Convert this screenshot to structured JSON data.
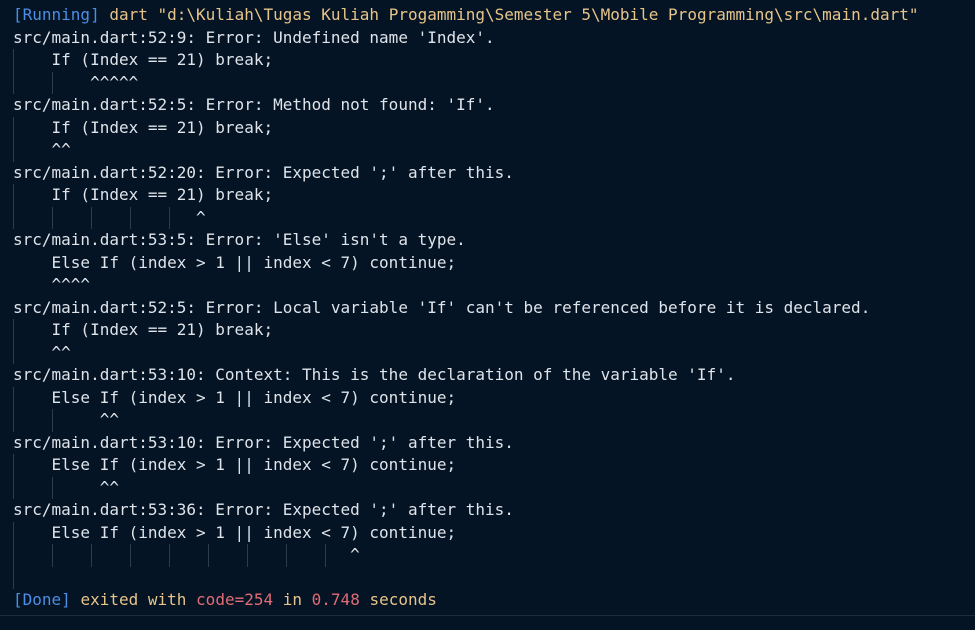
{
  "running_line": {
    "status": "[Running]",
    "command": "dart \"d:\\Kuliah\\Tugas Kuliah Progamming\\Semester 5\\Mobile Programming\\src\\main.dart\""
  },
  "errors": [
    {
      "header": "src/main.dart:52:9: Error: Undefined name 'Index'.",
      "code": "    If (Index == 21) break;",
      "marker": "        ^^^^^"
    },
    {
      "header": "src/main.dart:52:5: Error: Method not found: 'If'.",
      "code": "    If (Index == 21) break;",
      "marker": "    ^^"
    },
    {
      "header": "src/main.dart:52:20: Error: Expected ';' after this.",
      "code": "    If (Index == 21) break;",
      "marker": "                   ^"
    },
    {
      "header": "src/main.dart:53:5: Error: 'Else' isn't a type.",
      "code": "    Else If (index > 1 || index < 7) continue;",
      "marker": "    ^^^^"
    },
    {
      "header": "src/main.dart:52:5: Error: Local variable 'If' can't be referenced before it is declared.",
      "code": "    If (Index == 21) break;",
      "marker": "    ^^"
    },
    {
      "header": "src/main.dart:53:10: Context: This is the declaration of the variable 'If'.",
      "code": "    Else If (index > 1 || index < 7) continue;",
      "marker": "         ^^"
    },
    {
      "header": "src/main.dart:53:10: Error: Expected ';' after this.",
      "code": "    Else If (index > 1 || index < 7) continue;",
      "marker": "         ^^"
    },
    {
      "header": "src/main.dart:53:36: Error: Expected ';' after this.",
      "code": "    Else If (index > 1 || index < 7) continue;",
      "marker": "                                   ^"
    }
  ],
  "done_line": {
    "status": "[Done]",
    "exited_with": "exited with",
    "code": "code=254",
    "in_word": "in",
    "duration": "0.748",
    "seconds": "seconds"
  },
  "colors": {
    "background": "#041424",
    "status_blue": "#4c8ee6",
    "command_yellow": "#e7c48a",
    "code_red": "#e06c75"
  }
}
